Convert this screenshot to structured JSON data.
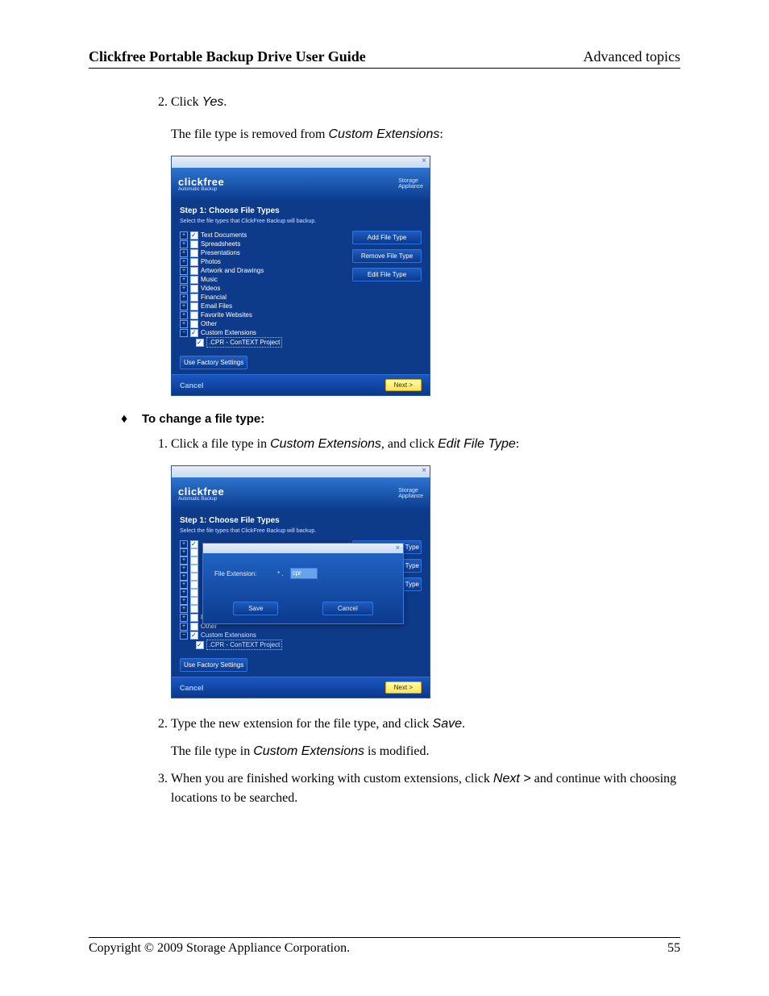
{
  "header": {
    "left": "Clickfree Portable Backup Drive User Guide",
    "right": "Advanced topics"
  },
  "section_a": {
    "step2_prefix": "Click ",
    "step2_term": "Yes",
    "step2_suffix": ".",
    "para_prefix": "The file type is removed from ",
    "para_term": "Custom Extensions",
    "para_suffix": ":"
  },
  "screenshot1": {
    "brand": "clickfree",
    "brand_sub": "Automatic Backup",
    "brand_right_line1": "Storage",
    "brand_right_line2": "Appliance",
    "step_title": "Step 1: Choose File Types",
    "step_sub": "Select the file types that ClickFree Backup will backup.",
    "close_x": "×",
    "tree": [
      {
        "label": "Text Documents",
        "checked": true
      },
      {
        "label": "Spreadsheets",
        "checked": false
      },
      {
        "label": "Presentations",
        "checked": false
      },
      {
        "label": "Photos",
        "checked": false
      },
      {
        "label": "Artwork and Drawings",
        "checked": false
      },
      {
        "label": "Music",
        "checked": false
      },
      {
        "label": "Videos",
        "checked": false
      },
      {
        "label": "Financial",
        "checked": false
      },
      {
        "label": "Email Files",
        "checked": false
      },
      {
        "label": "Favorite Websites",
        "checked": false
      },
      {
        "label": "Other",
        "checked": false
      },
      {
        "label": "Custom Extensions",
        "checked": true,
        "exp": "−"
      }
    ],
    "tree_child": ".CPR - ConTEXT Project",
    "side_buttons": [
      "Add File Type",
      "Remove File Type",
      "Edit File Type"
    ],
    "factory": "Use Factory Settings",
    "cancel": "Cancel",
    "next": "Next >"
  },
  "bullet_heading": {
    "symbol": "♦",
    "text": "To change a file type:"
  },
  "section_b": {
    "step1_prefix": "Click a file type in ",
    "step1_term1": "Custom Extensions",
    "step1_mid": ", and click ",
    "step1_term2": "Edit File Type",
    "step1_suffix": ":"
  },
  "screenshot2": {
    "brand": "clickfree",
    "brand_sub": "Automatic Backup",
    "brand_right_line1": "Storage",
    "brand_right_line2": "Appliance",
    "step_title": "Step 1: Choose File Types",
    "step_sub": "Select the file types that ClickFree Backup will backup.",
    "close_x": "×",
    "side_suffixes": [
      "Type",
      "le Type",
      "Type"
    ],
    "tree_bottom": [
      {
        "label": "Other",
        "checked": false
      },
      {
        "label": "Custom Extensions",
        "checked": true,
        "exp": "−"
      }
    ],
    "tree_bottom_extra": "Favorite Websites",
    "tree_child": ".CPR - ConTEXT Project",
    "factory": "Use Factory Settings",
    "cancel": "Cancel",
    "next": "Next >",
    "dialog": {
      "close_x": "×",
      "label": "File Extension:",
      "star": "* .",
      "value": "cpr",
      "save": "Save",
      "cancel": "Cancel"
    }
  },
  "section_c": {
    "step2_prefix": "Type the new extension for the file type, and click ",
    "step2_term": "Save",
    "step2_suffix": ".",
    "para2_prefix": "The file type in ",
    "para2_term": "Custom Extensions",
    "para2_suffix": " is modified.",
    "step3_prefix": "When you are finished working with custom extensions, click ",
    "step3_term": "Next >",
    "step3_suffix": " and continue with choosing locations to be searched."
  },
  "footer": {
    "left": "Copyright © 2009  Storage Appliance Corporation.",
    "right": "55"
  }
}
